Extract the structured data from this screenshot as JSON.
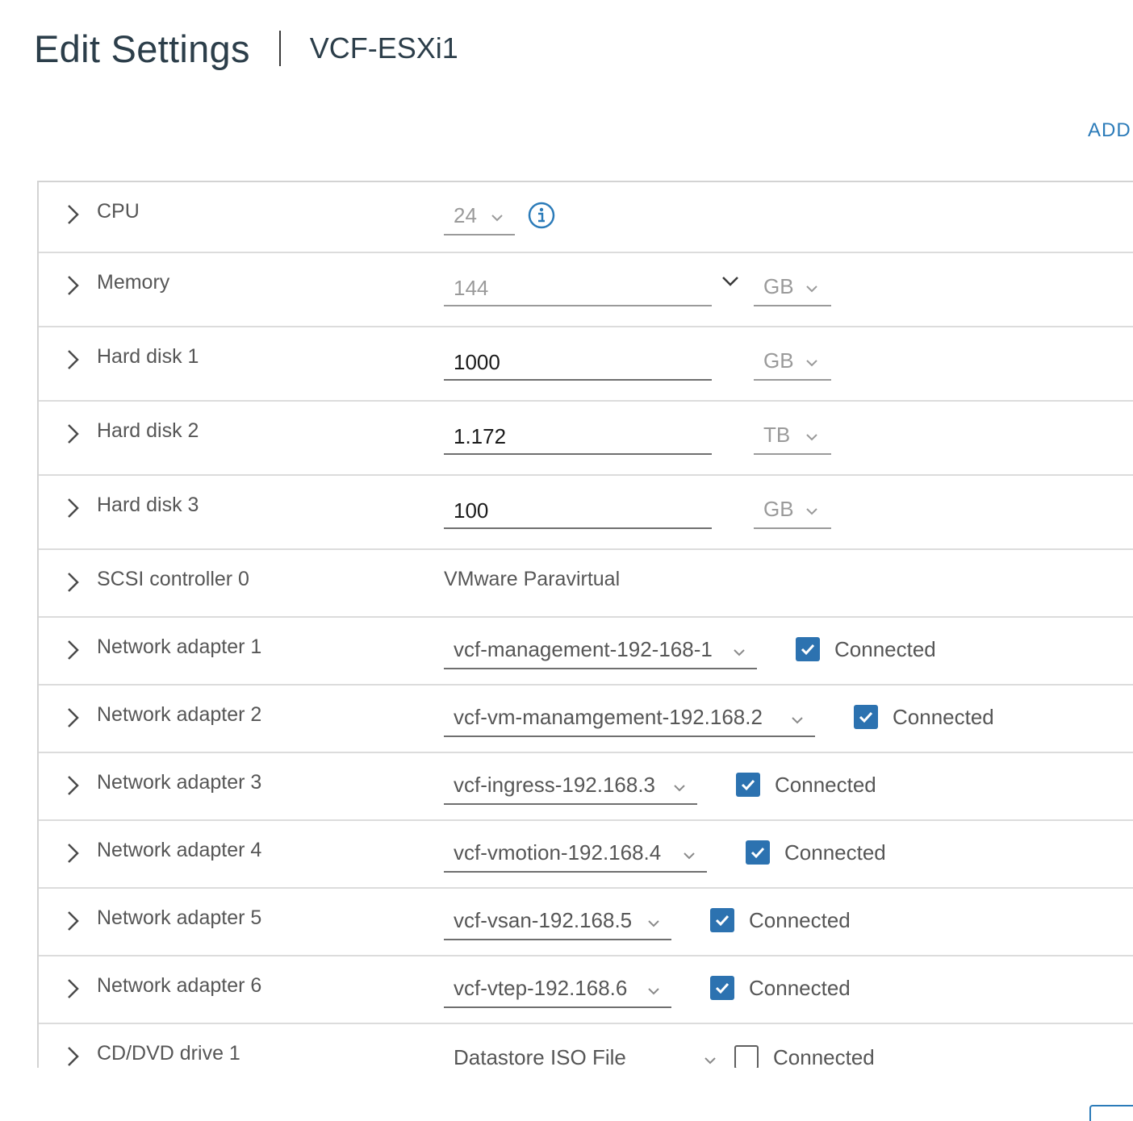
{
  "header": {
    "title": "Edit Settings",
    "vm_name": "VCF-ESXi1"
  },
  "add_link": "ADD",
  "rows": {
    "cpu": {
      "label": "CPU",
      "value": "24"
    },
    "memory": {
      "label": "Memory",
      "value": "144",
      "unit": "GB"
    },
    "hd1": {
      "label": "Hard disk 1",
      "value": "1000",
      "unit": "GB"
    },
    "hd2": {
      "label": "Hard disk 2",
      "value": "1.172",
      "unit": "TB"
    },
    "hd3": {
      "label": "Hard disk 3",
      "value": "100",
      "unit": "GB"
    },
    "scsi": {
      "label": "SCSI controller 0",
      "value": "VMware Paravirtual"
    },
    "net1": {
      "label": "Network adapter 1",
      "network": "vcf-management-192-168-1",
      "connected_label": "Connected",
      "connected": true
    },
    "net2": {
      "label": "Network adapter 2",
      "network": "vcf-vm-manamgement-192.168.2",
      "connected_label": "Connected",
      "connected": true
    },
    "net3": {
      "label": "Network adapter 3",
      "network": "vcf-ingress-192.168.3",
      "connected_label": "Connected",
      "connected": true
    },
    "net4": {
      "label": "Network adapter 4",
      "network": "vcf-vmotion-192.168.4",
      "connected_label": "Connected",
      "connected": true
    },
    "net5": {
      "label": "Network adapter 5",
      "network": "vcf-vsan-192.168.5",
      "connected_label": "Connected",
      "connected": true
    },
    "net6": {
      "label": "Network adapter 6",
      "network": "vcf-vtep-192.168.6",
      "connected_label": "Connected",
      "connected": true
    },
    "cd1": {
      "label": "CD/DVD drive 1",
      "source": "Datastore ISO File",
      "connected_label": "Connected",
      "connected": false
    }
  },
  "colors": {
    "accent": "#2b7bb9",
    "checkbox": "#2c72b0"
  },
  "icons": {
    "expand": "chevron-right-icon",
    "dropdown": "chevron-down-icon",
    "info": "info-icon",
    "check": "check-icon"
  }
}
